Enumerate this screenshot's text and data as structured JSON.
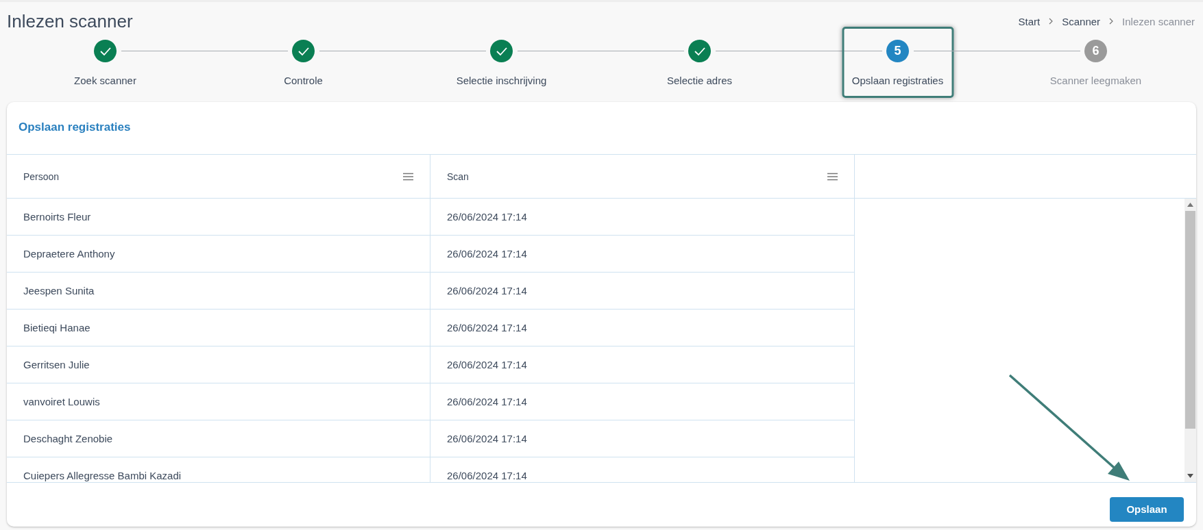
{
  "page_title": "Inlezen scanner",
  "breadcrumb": [
    {
      "label": "Start",
      "current": false
    },
    {
      "label": "Scanner",
      "current": false
    },
    {
      "label": "Inlezen scanner",
      "current": true
    }
  ],
  "steps": [
    {
      "label": "Zoek scanner",
      "kind": "done",
      "highlighted": false
    },
    {
      "label": "Controle",
      "kind": "done",
      "highlighted": false
    },
    {
      "label": "Selectie inschrijving",
      "kind": "done",
      "highlighted": false
    },
    {
      "label": "Selectie adres",
      "kind": "done",
      "highlighted": false
    },
    {
      "number": "5",
      "label": "Opslaan registraties",
      "kind": "current",
      "highlighted": true
    },
    {
      "number": "6",
      "label": "Scanner leegmaken",
      "kind": "pending",
      "highlighted": false
    }
  ],
  "card": {
    "title": "Opslaan registraties",
    "table": {
      "columns": [
        {
          "label": "Persoon",
          "menu": true
        },
        {
          "label": "Scan",
          "menu": true
        }
      ],
      "rows": [
        [
          "Bernoirts Fleur",
          "26/06/2024 17:14"
        ],
        [
          "Depraetere Anthony",
          "26/06/2024 17:14"
        ],
        [
          "Jeespen Sunita",
          "26/06/2024 17:14"
        ],
        [
          "Bietieqi Hanae",
          "26/06/2024 17:14"
        ],
        [
          "Gerritsen Julie",
          "26/06/2024 17:14"
        ],
        [
          "vanvoiret Louwis",
          "26/06/2024 17:14"
        ],
        [
          "Deschaght Zenobie",
          "26/06/2024 17:14"
        ],
        [
          "Cuiepers Allegresse Bambi Kazadi",
          "26/06/2024 17:14"
        ]
      ]
    },
    "button": "Opslaan"
  }
}
